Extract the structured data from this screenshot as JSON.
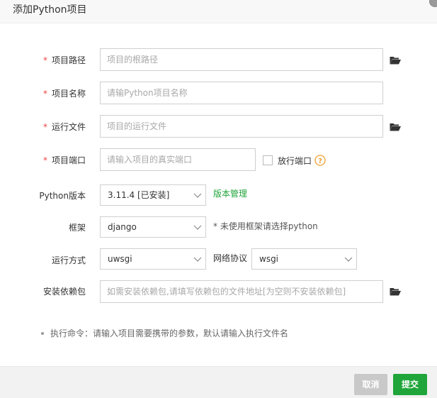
{
  "dialog": {
    "title": "添加Python项目"
  },
  "form": {
    "required_mark": "*",
    "project_path": {
      "label": "项目路径",
      "placeholder": "项目的根路径"
    },
    "project_name": {
      "label": "项目名称",
      "placeholder": "请输Python项目名称"
    },
    "run_file": {
      "label": "运行文件",
      "placeholder": "项目的运行文件"
    },
    "project_port": {
      "label": "项目端口",
      "placeholder": "请输入项目的真实端口",
      "open_port_label": "放行端口",
      "open_port_checked": false
    },
    "python_version": {
      "label": "Python版本",
      "value": "3.11.4 [已安装]",
      "manage_link": "版本管理"
    },
    "framework": {
      "label": "框架",
      "value": "django",
      "hint": "* 未使用框架请选择python"
    },
    "run_mode": {
      "label": "运行方式",
      "value": "uwsgi"
    },
    "network_protocol": {
      "label": "网络协议",
      "value": "wsgi"
    },
    "dependencies": {
      "label": "安装依赖包",
      "placeholder": "如需安装依赖包,请填写依赖包的文件地址[为空则不安装依赖包]"
    }
  },
  "tip": "执行命令：请输入项目需要携带的参数，默认请输入执行文件名",
  "footer": {
    "cancel_label": "取消",
    "submit_label": "提交"
  },
  "colors": {
    "accent": "#20a53a",
    "required": "#ef4444",
    "help": "#f0a030",
    "cancel_bg": "#c9c9c9"
  },
  "icons": {
    "folder": "folder-open-icon",
    "chevron": "chevron-down-icon",
    "help": "question-circle-icon",
    "close": "close-icon"
  }
}
